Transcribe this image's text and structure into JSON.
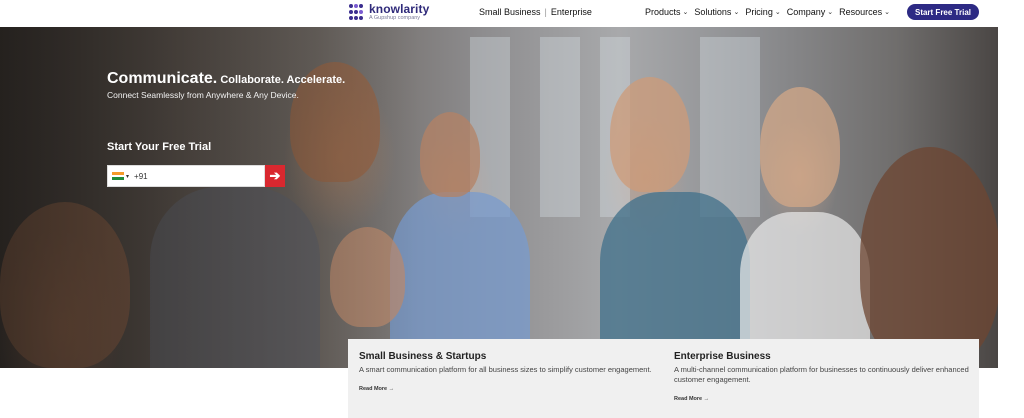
{
  "header": {
    "logo_name": "knowlarity",
    "logo_sub": "A Gupshup company",
    "segments": [
      "Small Business",
      "Enterprise"
    ],
    "nav": [
      "Products",
      "Solutions",
      "Pricing",
      "Company",
      "Resources"
    ],
    "cta_label": "Start Free Trial",
    "accent_color": "#2d2a84"
  },
  "hero": {
    "headline_big": "Communicate.",
    "headline_rest": "Collaborate. Accelerate.",
    "subline": "Connect Seamlessly from Anywhere & Any Device.",
    "trial_title": "Start Your Free Trial",
    "phone_value": "+91",
    "submit_icon": "arrow-right-icon",
    "submit_color": "#d9282f"
  },
  "cards": [
    {
      "title": "Small Business & Startups",
      "desc": "A smart communication platform for all business sizes to simplify customer engagement.",
      "link": "Read More →"
    },
    {
      "title": "Enterprise Business",
      "desc": "A multi-channel communication platform for businesses to continuously deliver enhanced customer engagement.",
      "link": "Read More →"
    }
  ]
}
